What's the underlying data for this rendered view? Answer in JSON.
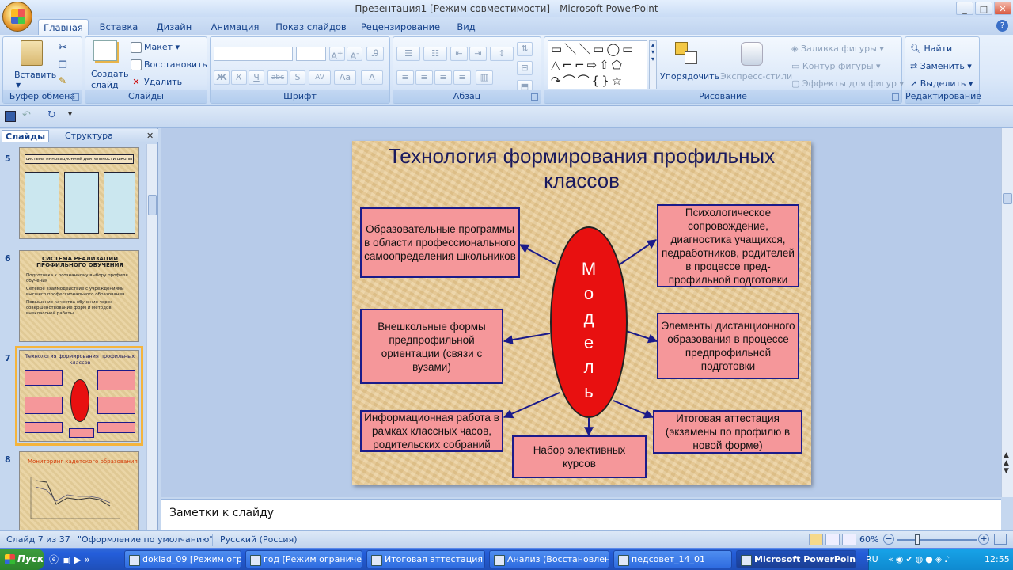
{
  "window": {
    "title": "Презентация1 [Режим совместимости] - Microsoft PowerPoint",
    "controls": [
      "_",
      "□",
      "✕"
    ]
  },
  "tabs": [
    "Главная",
    "Вставка",
    "Дизайн",
    "Анимация",
    "Показ слайдов",
    "Рецензирование",
    "Вид"
  ],
  "ribbon": {
    "clipboard": {
      "label": "Буфер обмена",
      "paste": "Вставить"
    },
    "slides": {
      "label": "Слайды",
      "create": "Создать",
      "create2": "слайд",
      "layout": "Макет",
      "reset": "Восстановить",
      "delete": "Удалить"
    },
    "font": {
      "label": "Шрифт"
    },
    "paragraph": {
      "label": "Абзац"
    },
    "drawing": {
      "label": "Рисование",
      "arrange": "Упорядочить",
      "quick_styles": "Экспресс-стили",
      "fill": "Заливка фигуры",
      "outline": "Контур фигуры",
      "effects": "Эффекты для фигур"
    },
    "editing": {
      "label": "Редактирование",
      "find": "Найти",
      "replace": "Заменить",
      "select": "Выделить"
    }
  },
  "pane": {
    "tab_slides": "Слайды",
    "tab_outline": "Структура",
    "thumbs": [
      {
        "num": "5",
        "title": "система инновационной деятельности школы"
      },
      {
        "num": "6",
        "title": "СИСТЕМА РЕАЛИЗАЦИИ ПРОФИЛЬНОГО ОБУЧЕНИЯ",
        "bullets": [
          "Подготовка к осознанному выбору профиля обучения",
          "Сетевое взаимодействие с учреждениями высшего профессионального образования",
          "Повышение качества обучения через совершенствование форм и методов внеклассной работы"
        ]
      },
      {
        "num": "7",
        "title": "Технология формирования профильных классов"
      },
      {
        "num": "8",
        "title": "Мониторинг кадетского образования"
      }
    ]
  },
  "slide": {
    "title": "Технология формирования профильных классов",
    "center": "Модель",
    "boxes": {
      "top_left": "Образовательные программы в области профессионального самоопределения школьников",
      "top_right": "Психологическое сопровождение, диагностика учащихся, педработников, родителей в процессе пред-профильной подготовки",
      "mid_left": "Внешкольные формы предпрофильной ориентации (связи с вузами)",
      "mid_right": "Элементы дистанционного образования в процессе предпрофильной подготовки",
      "bot_left": "Информационная работа в рамках классных часов, родительских собраний",
      "bot_center": "Набор элективных курсов",
      "bot_right": "Итоговая аттестация (экзамены по профилю в новой форме)"
    }
  },
  "notes": {
    "placeholder": "Заметки к слайду"
  },
  "status": {
    "slide": "Слайд 7 из 37",
    "theme": "\"Оформление по умолчанию\"",
    "lang": "Русский (Россия)",
    "zoom": "60%"
  },
  "taskbar": {
    "start": "Пуск",
    "items": [
      "doklad_09 [Режим огр...",
      "год [Режим ограниче...",
      "Итоговая аттестация...",
      "Анализ (Восстановлен...",
      "педсовет_14_01",
      "Microsoft PowerPoin..."
    ],
    "lang": "RU",
    "time": "12:55"
  }
}
